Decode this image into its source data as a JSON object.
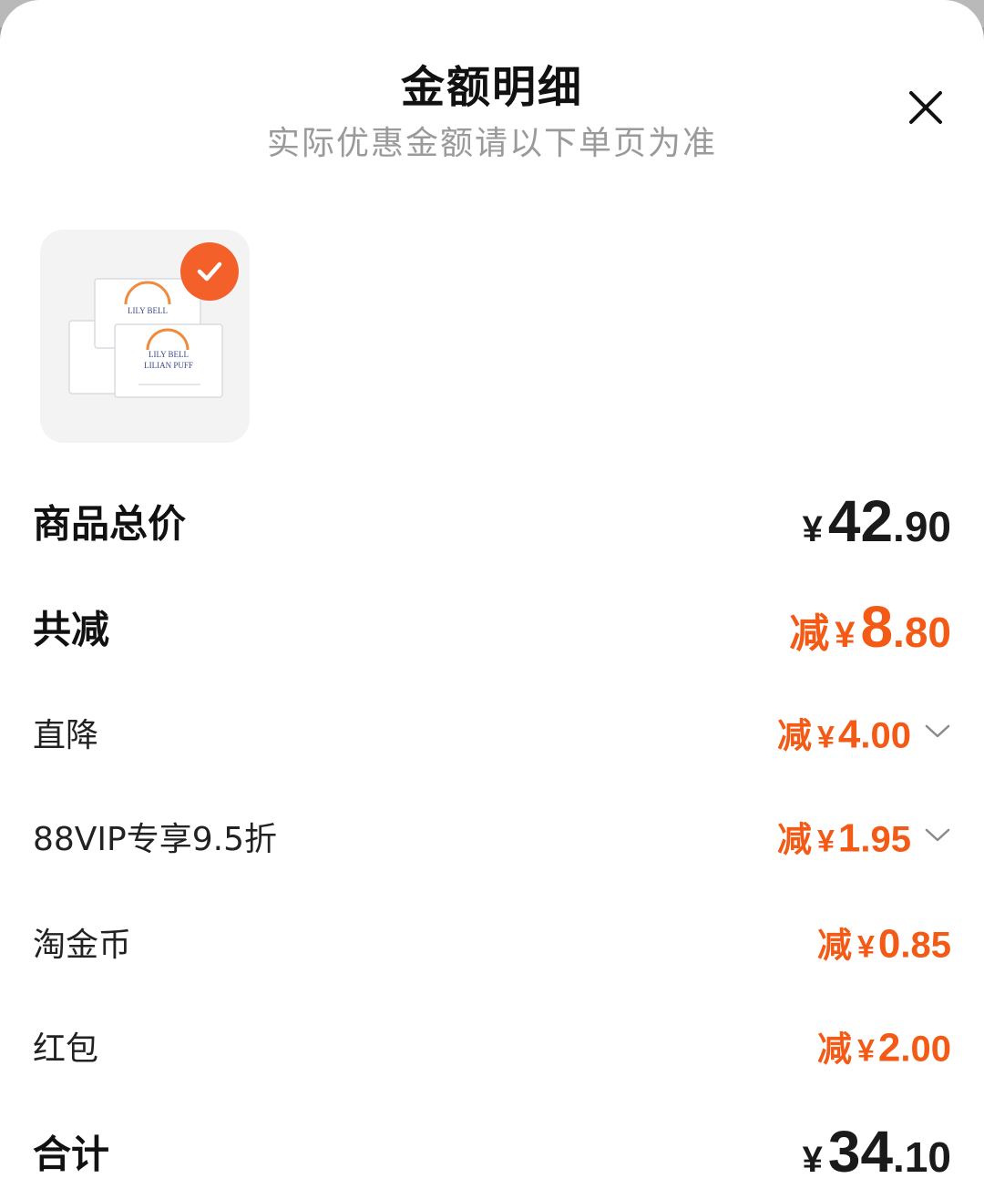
{
  "header": {
    "title": "金额明细",
    "subtitle": "实际优惠金额请以下单页为准"
  },
  "product": {
    "image_label_line1": "LILY BELL",
    "image_label_line2": "LILIAN PUFF"
  },
  "summary": {
    "total": {
      "label": "商品总价",
      "yen": "¥",
      "integer": "42",
      "decimal": ".90"
    },
    "total_discount": {
      "label": "共减",
      "prefix": "减",
      "yen": "¥",
      "integer": "8",
      "decimal": ".80"
    },
    "discounts": [
      {
        "label": "直降",
        "prefix": "减",
        "yen": "¥",
        "integer": "4",
        "decimal": ".00",
        "expandable": true
      },
      {
        "label": "88VIP专享9.5折",
        "prefix": "减",
        "yen": "¥",
        "integer": "1",
        "decimal": ".95",
        "expandable": true
      },
      {
        "label": "淘金币",
        "prefix": "减",
        "yen": "¥",
        "integer": "0",
        "decimal": ".85",
        "expandable": false
      },
      {
        "label": "红包",
        "prefix": "减",
        "yen": "¥",
        "integer": "2",
        "decimal": ".00",
        "expandable": false
      }
    ],
    "final": {
      "label": "合计",
      "yen": "¥",
      "integer": "34",
      "decimal": ".10"
    }
  },
  "colors": {
    "accent": "#f25a15",
    "badge": "#f4602a",
    "text": "#111111",
    "subtext": "#9a9a9a"
  },
  "icons": {
    "close": "close-icon",
    "check": "check-icon",
    "chevron": "chevron-down-icon"
  }
}
